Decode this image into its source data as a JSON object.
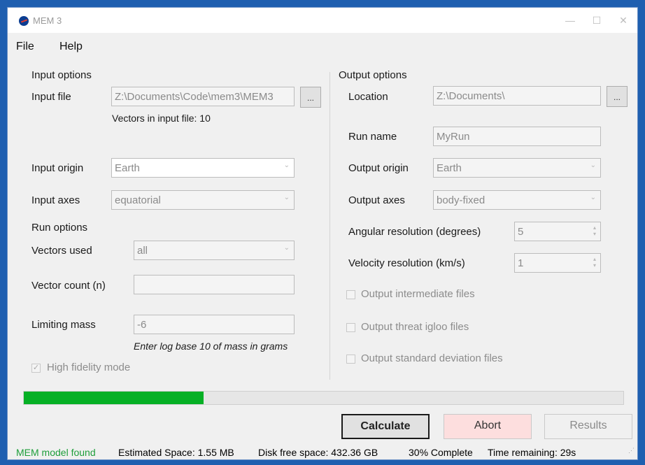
{
  "window": {
    "title": "MEM 3",
    "minimize": "—",
    "maximize": "☐",
    "close": "✕"
  },
  "menu": {
    "file": "File",
    "help": "Help"
  },
  "input": {
    "section_title": "Input options",
    "file_label": "Input file",
    "file_value": "Z:\\Documents\\Code\\mem3\\MEM3",
    "browse": "...",
    "vectors_info": "Vectors in input file: 10",
    "origin_label": "Input origin",
    "origin_value": "Earth",
    "axes_label": "Input axes",
    "axes_value": "equatorial"
  },
  "run": {
    "section_title": "Run options",
    "vectors_used_label": "Vectors used",
    "vectors_used_value": "all",
    "vector_count_label": "Vector count (n)",
    "vector_count_value": "",
    "limiting_mass_label": "Limiting mass",
    "limiting_mass_value": "-6",
    "mass_hint": "Enter log base 10 of mass in grams",
    "high_fidelity_label": "High fidelity mode",
    "high_fidelity_checked": true
  },
  "output": {
    "section_title": "Output options",
    "location_label": "Location",
    "location_value": "Z:\\Documents\\",
    "browse": "...",
    "run_name_label": "Run name",
    "run_name_value": "MyRun",
    "origin_label": "Output origin",
    "origin_value": "Earth",
    "axes_label": "Output axes",
    "axes_value": "body-fixed",
    "angular_label": "Angular resolution (degrees)",
    "angular_value": "5",
    "velocity_label": "Velocity resolution (km/s)",
    "velocity_value": "1",
    "intermediate_label": "Output intermediate files",
    "igloo_label": "Output threat igloo files",
    "stddev_label": "Output standard deviation files"
  },
  "progress": {
    "fraction": 0.3
  },
  "buttons": {
    "calculate": "Calculate",
    "abort": "Abort",
    "results": "Results"
  },
  "status": {
    "model": "MEM model found",
    "space": "Estimated Space: 1.55 MB",
    "disk": "Disk free space: 432.36 GB",
    "complete": "30% Complete",
    "time": "Time remaining: 29s"
  },
  "colors": {
    "status_ok": "#1e9e3a",
    "progress": "#06b025",
    "abort_bg": "#fddede"
  },
  "icons": {
    "app": "nasa-logo-icon",
    "dropdown": "chevron-down-icon",
    "spinner": "spin-arrows-icon",
    "resize": "resize-grip-icon"
  }
}
